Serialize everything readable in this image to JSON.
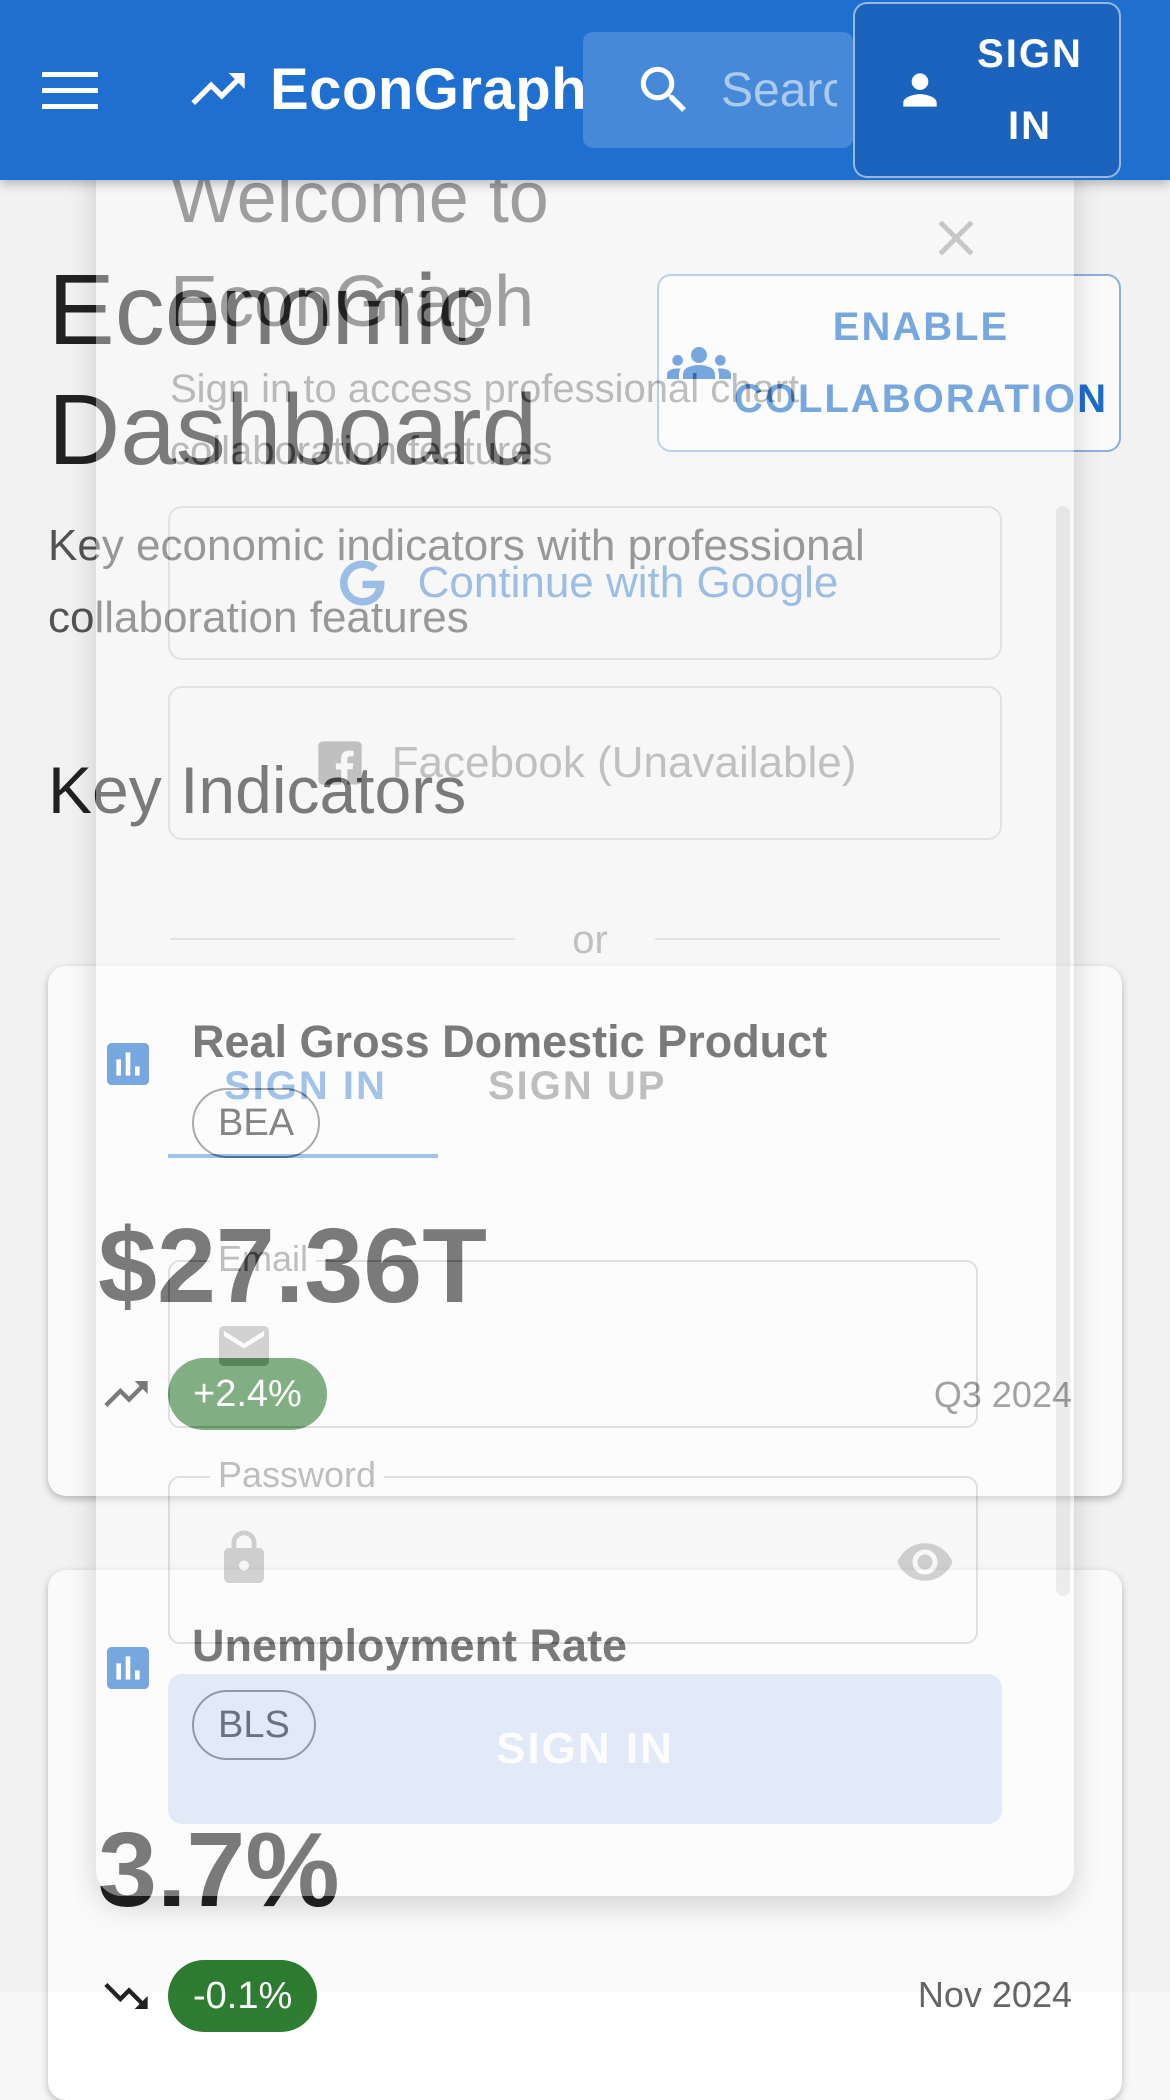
{
  "app": {
    "title": "EconGraph",
    "search_placeholder": "Search",
    "sign_in_label": "SIGN IN"
  },
  "dashboard": {
    "title": "Economic Dashboard",
    "subtitle": "Key economic indicators with professional collaboration features",
    "collaboration_button": "ENABLE COLLABORATION",
    "section_title": "Key Indicators",
    "cards": [
      {
        "name": "Real Gross Domestic Product",
        "source": "BEA",
        "value": "$27.36T",
        "change": "+2.4%",
        "date": "Q3 2024"
      },
      {
        "name": "Unemployment Rate",
        "source": "BLS",
        "value": "3.7%",
        "change": "-0.1%",
        "date": "Nov 2024"
      }
    ]
  },
  "dialog": {
    "title": "Welcome to EconGraph",
    "subtitle": "Sign in to access professional chart collaboration features",
    "google_button": "Continue with Google",
    "facebook_button": "Facebook (Unavailable)",
    "divider_text": "or",
    "tabs": [
      "SIGN IN",
      "SIGN UP"
    ],
    "email_label": "Email",
    "password_label": "Password",
    "submit_label": "SIGN IN"
  },
  "colors": {
    "primary": "#1e6fd0",
    "positive": "#2e7d32",
    "surface": "#ffffff"
  },
  "icons": [
    "menu-icon",
    "trending-up-icon",
    "search-icon",
    "person-icon",
    "group-icon",
    "bar-chart-icon",
    "close-icon",
    "google-icon",
    "facebook-icon",
    "email-icon",
    "lock-icon",
    "visibility-icon"
  ]
}
